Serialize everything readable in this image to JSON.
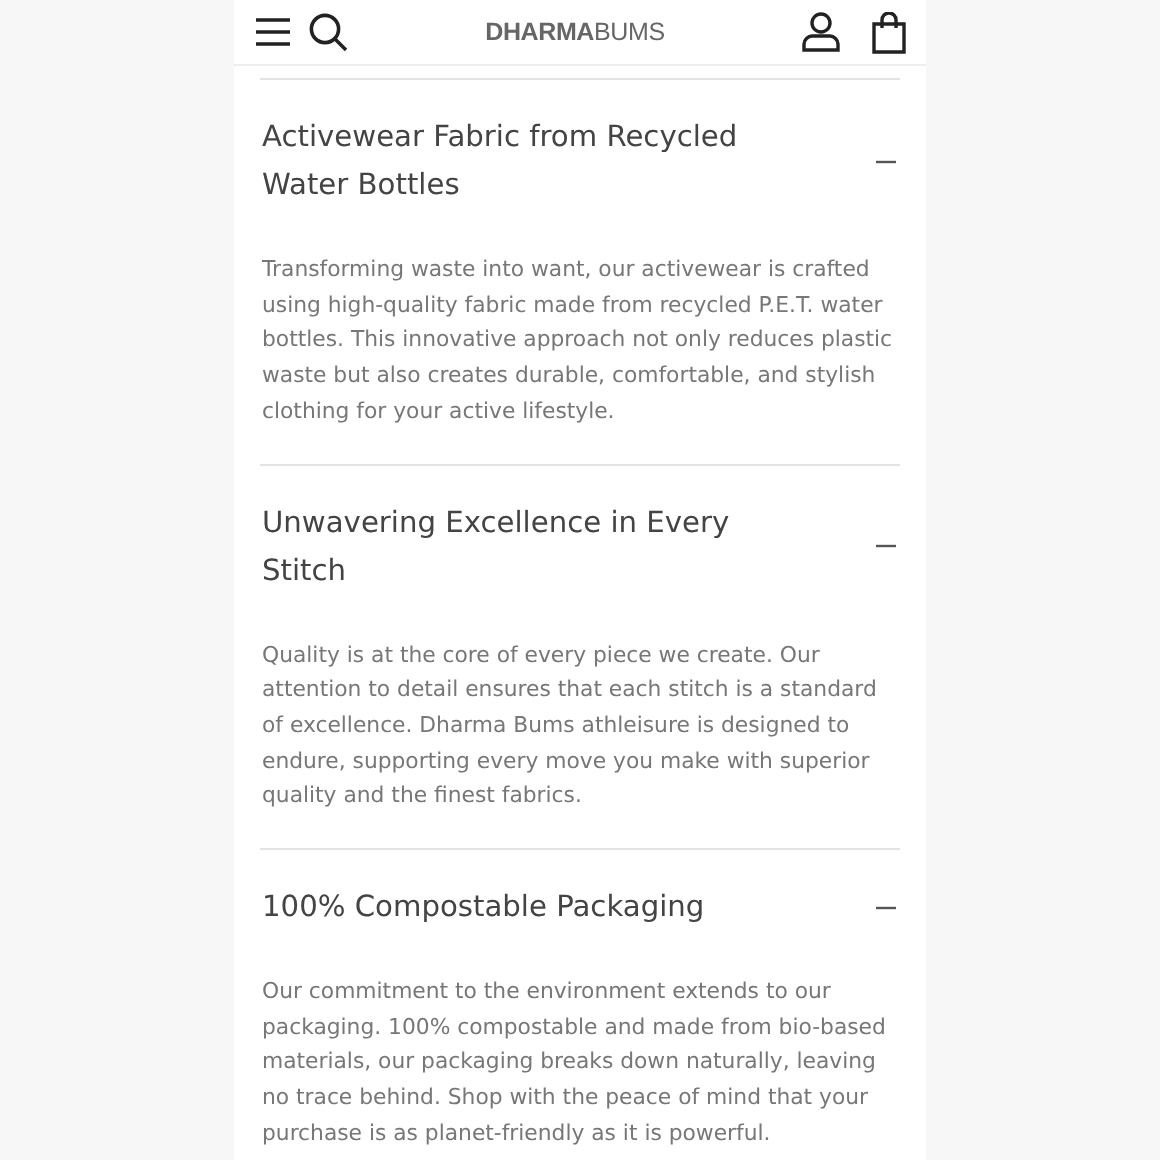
{
  "header": {
    "logo": "**DHARMA**BUMS"
  },
  "sections": [
    {
      "title": "Activewear Fabric from Recycled Water Bottles",
      "expanded": true,
      "body": "Transforming waste into want, our activewear is crafted using high-quality fabric made from recycled P.E.T. water bottles. This innovative approach not only reduces plastic waste but also creates durable, comfortable, and stylish clothing for your active lifestyle."
    },
    {
      "title": "Unwavering Excellence in Every Stitch",
      "expanded": true,
      "body": "Quality is at the core of every piece we create. Our attention to detail ensures that each stitch is a standard of excellence. Dharma Bums athleisure is designed to endure, supporting every move you make with superior quality and the finest fabrics."
    },
    {
      "title": "100% Compostable Packaging",
      "expanded": true,
      "body": "Our commitment to the environment extends to our packaging. 100% compostable and made from bio-based materials, our packaging breaks down naturally, leaving no trace behind. Shop with the peace of mind that your purchase is as planet-friendly as it is powerful."
    }
  ]
}
